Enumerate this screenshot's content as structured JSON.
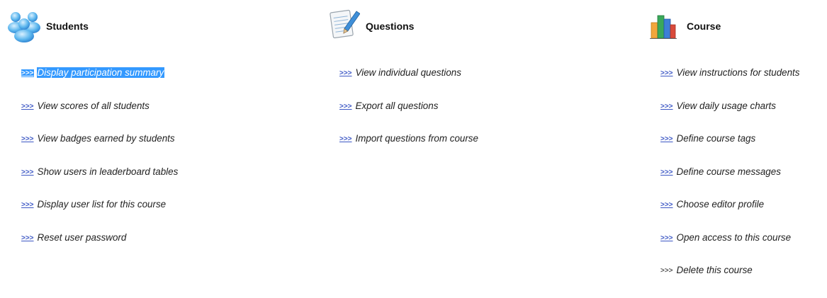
{
  "columns": [
    {
      "title": "Students",
      "icon": "people-icon",
      "items": [
        {
          "label": "Display participation summary",
          "selected": true
        },
        {
          "label": "View scores of all students"
        },
        {
          "label": "View badges earned by students"
        },
        {
          "label": "Show users in leaderboard tables"
        },
        {
          "label": "Display user list for this course"
        },
        {
          "label": "Reset user password"
        }
      ]
    },
    {
      "title": "Questions",
      "icon": "notepad-pen-icon",
      "items": [
        {
          "label": "View individual questions"
        },
        {
          "label": "Export all questions"
        },
        {
          "label": "Import questions from course"
        }
      ]
    },
    {
      "title": "Course",
      "icon": "bar-chart-icon",
      "items": [
        {
          "label": "View instructions for students"
        },
        {
          "label": "View daily usage charts"
        },
        {
          "label": "Define course tags"
        },
        {
          "label": "Define course messages"
        },
        {
          "label": "Choose editor profile"
        },
        {
          "label": "Open access to this course"
        },
        {
          "label": "Delete this course"
        }
      ]
    }
  ],
  "link_marker": ">>>",
  "colors": {
    "selection": "#3399ff",
    "marker": "#3b56c4",
    "text": "#222222"
  }
}
